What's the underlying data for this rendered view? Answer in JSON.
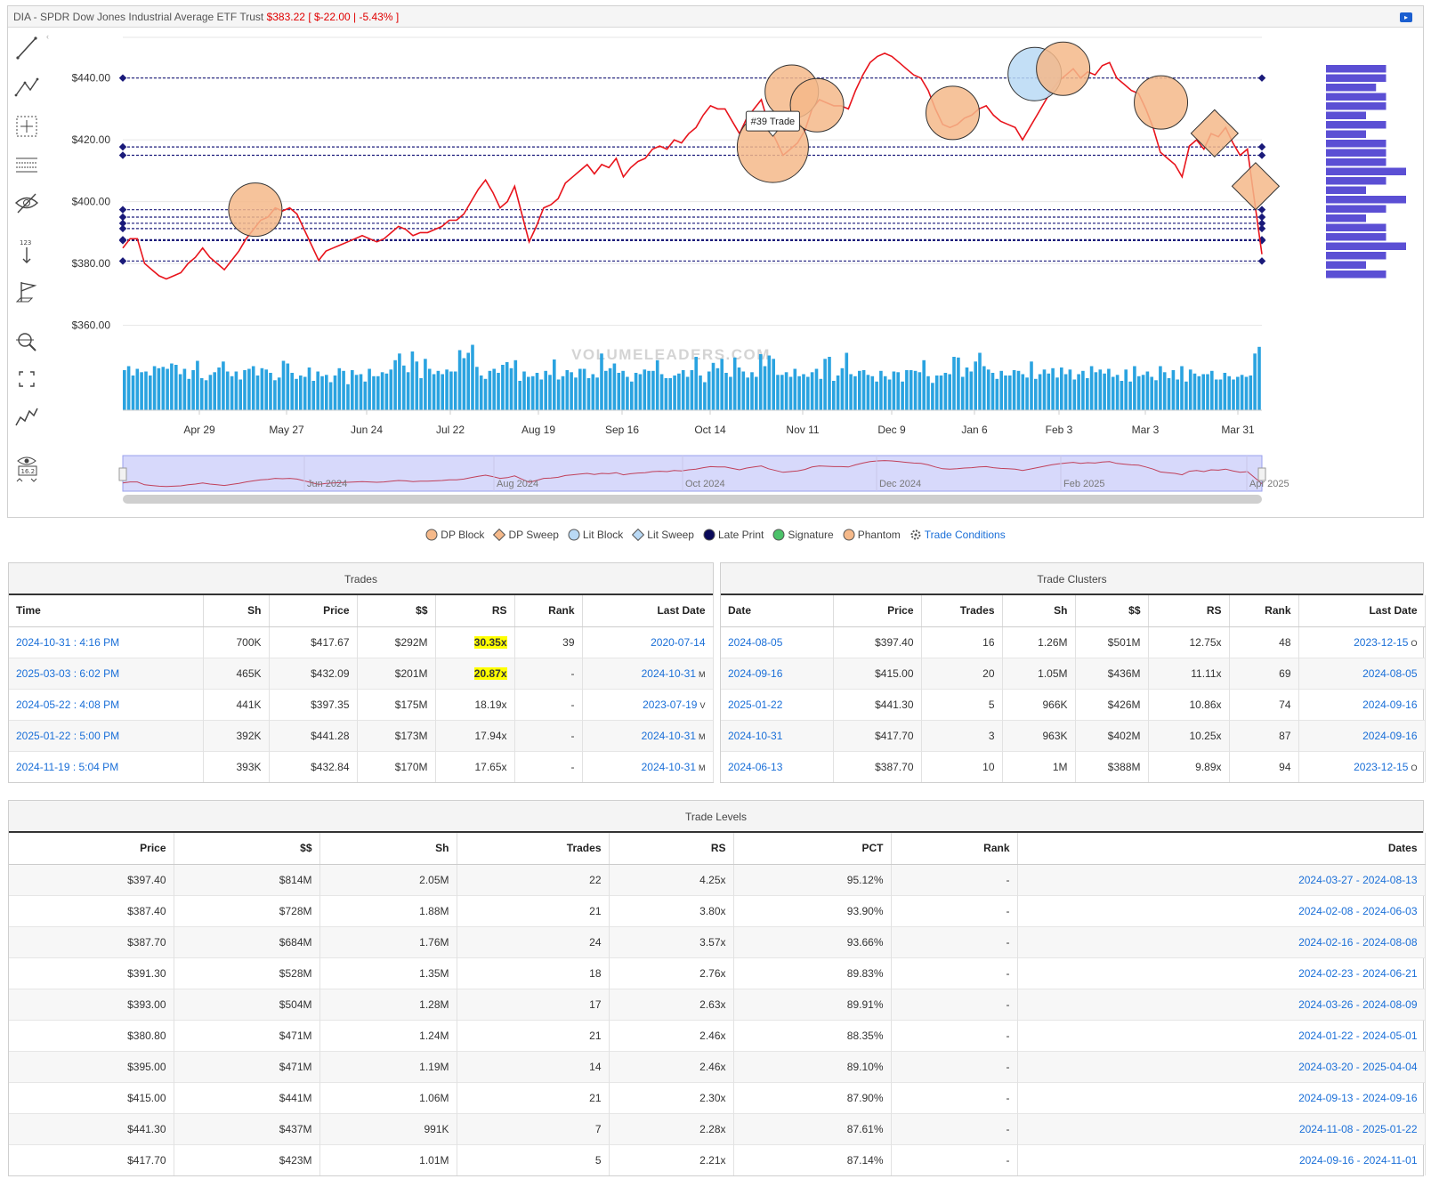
{
  "header": {
    "ticker_name": "DIA - SPDR Dow Jones Industrial Average ETF Trust",
    "price": "$383.22",
    "change": "[ $-22.00 | -5.43% ]"
  },
  "toolbar": {
    "tools": [
      "line-tool-icon",
      "pattern-tool-icon",
      "crosshair-tool-icon",
      "fibonacci-tool-icon",
      "hide-drawings-icon",
      "price-marker-icon",
      "flag-marker-icon",
      "zoom-tool-icon",
      "fullscreen-icon",
      "chart-type-icon",
      "visibility-toggle-icon"
    ],
    "collapse_glyph": "‹",
    "visibility_value": "16.2"
  },
  "chart_data": {
    "type": "line",
    "y_ticks": [
      "$440.00",
      "$420.00",
      "$400.00",
      "$380.00",
      "$360.00"
    ],
    "ylim": [
      357,
      452
    ],
    "x_ticks": [
      "Apr 29",
      "May 27",
      "Jun 24",
      "Jul 22",
      "Aug 19",
      "Sep 16",
      "Oct 14",
      "Nov 11",
      "Dec 9",
      "Jan 6",
      "Feb 3",
      "Mar 3",
      "Mar 31"
    ],
    "navigator_labels": [
      "Jun 2024",
      "Aug 2024",
      "Oct 2024",
      "Dec 2024",
      "Feb 2025",
      "Apr 2025"
    ],
    "watermark": "VOLUMELEADERS.COM",
    "tooltip": "#39 Trade",
    "series": [
      {
        "color": "#e8141c",
        "x_start": "2024-04-08",
        "x_end": "2025-04-04",
        "values": [
          385,
          388,
          388,
          380,
          378,
          376,
          375,
          376,
          377,
          380,
          382,
          385,
          382,
          380,
          378,
          381,
          384,
          388,
          391,
          394,
          395,
          398,
          397,
          398,
          396,
          391,
          386,
          381,
          384,
          385,
          386,
          387,
          388,
          389,
          388,
          387,
          388,
          390,
          392,
          391,
          389,
          390,
          390,
          391,
          392,
          394,
          394,
          396,
          400,
          404,
          407,
          403,
          398,
          400,
          405,
          396,
          387,
          392,
          398,
          399,
          401,
          406,
          408,
          410,
          412,
          409,
          412,
          411,
          414,
          408,
          411,
          413,
          414,
          417,
          418,
          417,
          420,
          419,
          422,
          424,
          428,
          431,
          430,
          430,
          426,
          422,
          427,
          430,
          433,
          425,
          420,
          415,
          417,
          419,
          423,
          430,
          433,
          432,
          431,
          431,
          430,
          436,
          441,
          445,
          447,
          448,
          447,
          445,
          443,
          441,
          440,
          436,
          430,
          425,
          424,
          425,
          427,
          428,
          430,
          431,
          428,
          426,
          425,
          424,
          420,
          424,
          428,
          432,
          436,
          439,
          441,
          443,
          440,
          442,
          441,
          444,
          445,
          440,
          438,
          436,
          435,
          430,
          424,
          416,
          414,
          412,
          408,
          418,
          420,
          417,
          422,
          421,
          424,
          419,
          415,
          417,
          400,
          383
        ]
      }
    ],
    "price_levels": [
      440.0,
      417.7,
      415.0,
      397.4,
      395.0,
      393.0,
      391.3,
      387.7,
      387.4,
      380.8
    ],
    "markers": [
      {
        "type": "DP Block",
        "x": "2024-05-20",
        "y": 397.4
      },
      {
        "type": "DP Block",
        "x": "2024-10-31",
        "y": 417.7
      },
      {
        "type": "DP Block",
        "x": "2024-11-06",
        "y": 435.6
      },
      {
        "type": "DP Block",
        "x": "2024-11-14",
        "y": 431.2
      },
      {
        "type": "DP Block",
        "x": "2024-12-27",
        "y": 428.7
      },
      {
        "type": "Lit Block",
        "x": "2025-01-22",
        "y": 441.28
      },
      {
        "type": "DP Block",
        "x": "2025-01-31",
        "y": 443.0
      },
      {
        "type": "DP Block",
        "x": "2025-03-03",
        "y": 432.09
      },
      {
        "type": "DP Sweep",
        "x": "2025-03-20",
        "y": 422.1
      },
      {
        "type": "DP Sweep",
        "x": "2025-04-02",
        "y": 405.0
      }
    ],
    "volume_profile": [
      440,
      440,
      430,
      440,
      440,
      420,
      440,
      420,
      440,
      440,
      440,
      460,
      440,
      420,
      460,
      440,
      420,
      440,
      440,
      460,
      440,
      420,
      440
    ],
    "volume_bars": [
      60,
      66,
      52,
      62,
      57,
      58,
      52,
      66,
      63,
      65,
      62,
      70,
      68,
      54,
      62,
      47,
      60,
      74,
      48,
      45,
      53,
      57,
      64,
      73,
      58,
      51,
      58,
      46,
      60,
      62,
      66,
      52,
      63,
      61,
      56,
      45,
      49,
      74,
      70,
      56,
      47,
      52,
      50,
      64,
      44,
      58,
      51,
      53,
      42,
      52,
      63,
      59,
      39,
      60,
      53,
      54,
      43,
      62,
      51,
      51,
      57,
      55,
      61,
      75,
      85,
      67,
      57,
      88,
      73,
      48,
      77,
      62,
      54,
      59,
      54,
      61,
      58,
      58,
      90,
      78,
      86,
      98,
      65,
      52,
      47,
      59,
      62,
      56,
      68,
      72,
      63,
      75,
      44,
      58,
      50,
      51,
      56,
      46,
      59,
      53,
      76,
      46,
      51,
      60,
      57,
      49,
      62,
      62,
      48,
      54,
      49,
      85,
      59,
      63,
      70,
      56,
      59,
      50,
      43,
      56,
      54,
      61,
      59,
      59,
      75,
      54,
      48,
      48,
      52,
      55,
      60,
      50,
      60,
      80,
      52,
      42,
      58,
      71,
      63,
      77,
      56,
      50,
      79,
      64,
      58,
      49,
      57,
      50,
      84,
      66,
      82,
      77,
      53,
      53,
      57,
      50,
      62,
      51,
      54,
      50,
      57,
      62,
      47,
      77,
      80,
      44,
      52,
      63,
      86,
      54,
      51,
      59,
      60,
      53,
      51,
      43,
      59,
      51,
      46,
      58,
      57,
      43,
      60,
      60,
      59,
      57,
      75,
      51,
      41,
      52,
      52,
      56,
      54,
      80,
      79,
      50,
      64,
      58,
      73,
      86,
      66,
      61,
      56,
      47,
      59,
      52,
      52,
      60,
      59,
      54,
      49,
      73,
      47,
      54,
      61,
      55,
      63,
      49,
      64,
      54,
      61,
      46,
      54,
      59,
      48,
      66,
      57,
      61,
      55,
      62,
      50,
      53,
      44,
      61,
      43,
      66,
      51,
      53,
      58,
      50,
      45,
      66,
      57,
      48,
      60,
      46,
      66,
      43,
      61,
      55,
      51,
      54,
      54,
      59,
      46,
      46,
      56,
      51,
      46,
      50,
      53,
      50,
      52,
      85,
      95
    ]
  },
  "legend": [
    {
      "label": "DP Block",
      "shape": "circle",
      "color": "#f5b98a"
    },
    {
      "label": "DP Sweep",
      "shape": "diamond",
      "color": "#f5b98a"
    },
    {
      "label": "Lit Block",
      "shape": "circle",
      "color": "#b9d9f5"
    },
    {
      "label": "Lit Sweep",
      "shape": "diamond",
      "color": "#b9d9f5"
    },
    {
      "label": "Late Print",
      "shape": "circle",
      "color": "#0a0a5a"
    },
    {
      "label": "Signature",
      "shape": "circle",
      "color": "#4cc26a"
    },
    {
      "label": "Phantom",
      "shape": "circle",
      "color": "#f5b98a"
    },
    {
      "label": "Trade Conditions",
      "shape": "gear",
      "color": "#1a6fd8"
    }
  ],
  "trades": {
    "title": "Trades",
    "headers": [
      "Time",
      "Sh",
      "Price",
      "$$",
      "RS",
      "Rank",
      "Last Date"
    ],
    "rows": [
      {
        "time": "2024-10-31 : 4:16 PM",
        "sh": "700K",
        "price": "$417.67",
        "dollars": "$292M",
        "rs": "30.35x",
        "rank": "39",
        "last_date": "2020-07-14",
        "flag": ""
      },
      {
        "time": "2025-03-03 : 6:02 PM",
        "sh": "465K",
        "price": "$432.09",
        "dollars": "$201M",
        "rs": "20.87x",
        "rank": "-",
        "last_date": "2024-10-31",
        "flag": "M"
      },
      {
        "time": "2024-05-22 : 4:08 PM",
        "sh": "441K",
        "price": "$397.35",
        "dollars": "$175M",
        "rs": "18.19x",
        "rank": "-",
        "last_date": "2023-07-19",
        "flag": "V"
      },
      {
        "time": "2025-01-22 : 5:00 PM",
        "sh": "392K",
        "price": "$441.28",
        "dollars": "$173M",
        "rs": "17.94x",
        "rank": "-",
        "last_date": "2024-10-31",
        "flag": "M"
      },
      {
        "time": "2024-11-19 : 5:04 PM",
        "sh": "393K",
        "price": "$432.84",
        "dollars": "$170M",
        "rs": "17.65x",
        "rank": "-",
        "last_date": "2024-10-31",
        "flag": "M"
      }
    ]
  },
  "clusters": {
    "title": "Trade Clusters",
    "headers": [
      "Date",
      "Price",
      "Trades",
      "Sh",
      "$$",
      "RS",
      "Rank",
      "Last Date"
    ],
    "rows": [
      {
        "date": "2024-08-05",
        "price": "$397.40",
        "trades": "16",
        "sh": "1.26M",
        "dollars": "$501M",
        "rs": "12.75x",
        "rank": "48",
        "last_date": "2023-12-15",
        "flag": "O"
      },
      {
        "date": "2024-09-16",
        "price": "$415.00",
        "trades": "20",
        "sh": "1.05M",
        "dollars": "$436M",
        "rs": "11.11x",
        "rank": "69",
        "last_date": "2024-08-05",
        "flag": ""
      },
      {
        "date": "2025-01-22",
        "price": "$441.30",
        "trades": "5",
        "sh": "966K",
        "dollars": "$426M",
        "rs": "10.86x",
        "rank": "74",
        "last_date": "2024-09-16",
        "flag": ""
      },
      {
        "date": "2024-10-31",
        "price": "$417.70",
        "trades": "3",
        "sh": "963K",
        "dollars": "$402M",
        "rs": "10.25x",
        "rank": "87",
        "last_date": "2024-09-16",
        "flag": ""
      },
      {
        "date": "2024-06-13",
        "price": "$387.70",
        "trades": "10",
        "sh": "1M",
        "dollars": "$388M",
        "rs": "9.89x",
        "rank": "94",
        "last_date": "2023-12-15",
        "flag": "O"
      }
    ]
  },
  "levels": {
    "title": "Trade Levels",
    "headers": [
      "Price",
      "$$",
      "Sh",
      "Trades",
      "RS",
      "PCT",
      "Rank",
      "Dates"
    ],
    "rows": [
      {
        "price": "$397.40",
        "dollars": "$814M",
        "sh": "2.05M",
        "trades": "22",
        "rs": "4.25x",
        "pct": "95.12%",
        "rank": "-",
        "dates": "2024-03-27 - 2024-08-13"
      },
      {
        "price": "$387.40",
        "dollars": "$728M",
        "sh": "1.88M",
        "trades": "21",
        "rs": "3.80x",
        "pct": "93.90%",
        "rank": "-",
        "dates": "2024-02-08 - 2024-06-03"
      },
      {
        "price": "$387.70",
        "dollars": "$684M",
        "sh": "1.76M",
        "trades": "24",
        "rs": "3.57x",
        "pct": "93.66%",
        "rank": "-",
        "dates": "2024-02-16 - 2024-08-08"
      },
      {
        "price": "$391.30",
        "dollars": "$528M",
        "sh": "1.35M",
        "trades": "18",
        "rs": "2.76x",
        "pct": "89.83%",
        "rank": "-",
        "dates": "2024-02-23 - 2024-06-21"
      },
      {
        "price": "$393.00",
        "dollars": "$504M",
        "sh": "1.28M",
        "trades": "17",
        "rs": "2.63x",
        "pct": "89.91%",
        "rank": "-",
        "dates": "2024-03-26 - 2024-08-09"
      },
      {
        "price": "$380.80",
        "dollars": "$471M",
        "sh": "1.24M",
        "trades": "21",
        "rs": "2.46x",
        "pct": "88.35%",
        "rank": "-",
        "dates": "2024-01-22 - 2024-05-01"
      },
      {
        "price": "$395.00",
        "dollars": "$471M",
        "sh": "1.19M",
        "trades": "14",
        "rs": "2.46x",
        "pct": "89.10%",
        "rank": "-",
        "dates": "2024-03-20 - 2025-04-04"
      },
      {
        "price": "$415.00",
        "dollars": "$441M",
        "sh": "1.06M",
        "trades": "21",
        "rs": "2.30x",
        "pct": "87.90%",
        "rank": "-",
        "dates": "2024-09-13 - 2024-09-16"
      },
      {
        "price": "$441.30",
        "dollars": "$437M",
        "sh": "991K",
        "trades": "7",
        "rs": "2.28x",
        "pct": "87.61%",
        "rank": "-",
        "dates": "2024-11-08 - 2025-01-22"
      },
      {
        "price": "$417.70",
        "dollars": "$423M",
        "sh": "1.01M",
        "trades": "5",
        "rs": "2.21x",
        "pct": "87.14%",
        "rank": "-",
        "dates": "2024-09-16 - 2024-11-01"
      }
    ]
  }
}
